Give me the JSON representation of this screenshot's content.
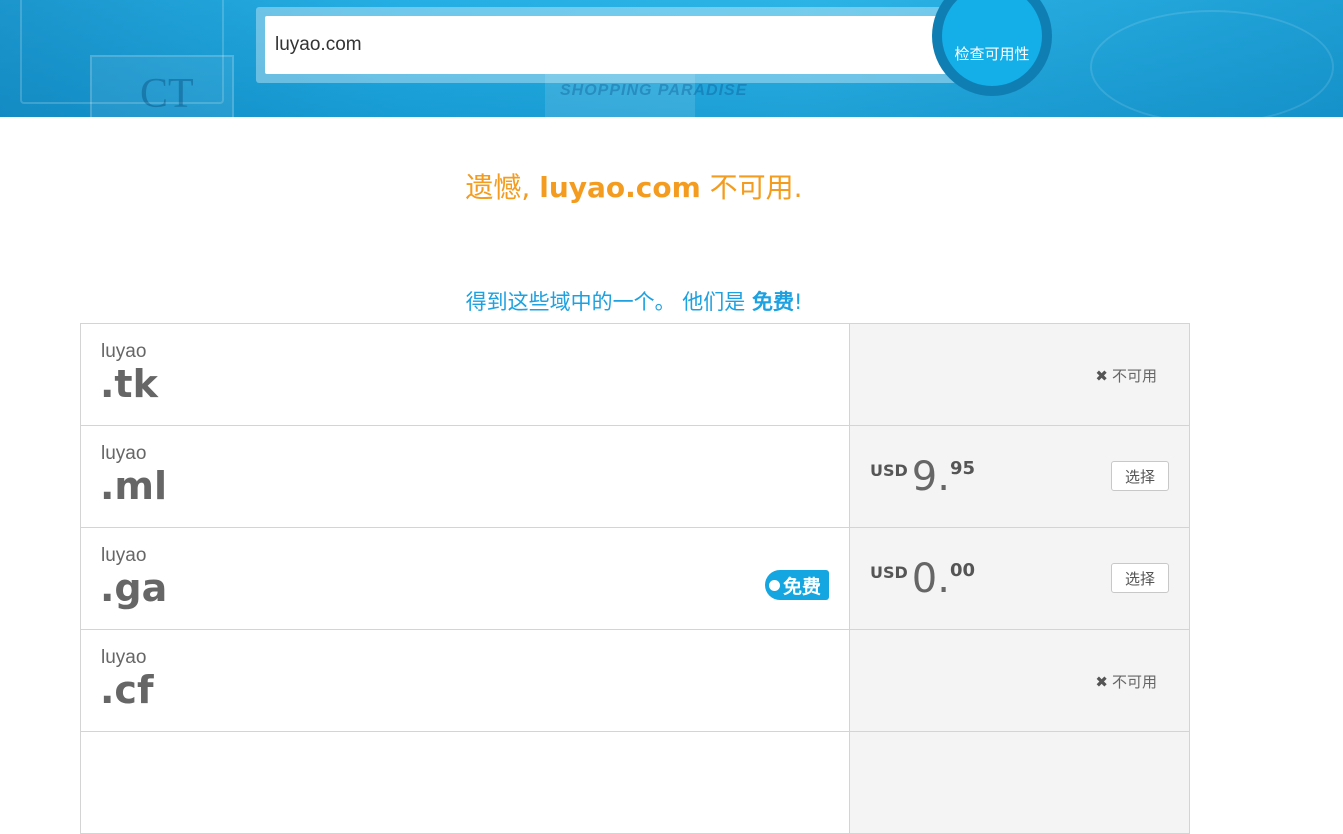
{
  "search": {
    "value": "luyao.com",
    "button_label": "检查可用性"
  },
  "hero_decor": {
    "sign_text": "SHOPPING PARADISE",
    "ct_text": "CT"
  },
  "result": {
    "prefix": "遗憾, ",
    "domain": "luyao.com",
    "suffix": " 不可用."
  },
  "offer": {
    "text": "得到这些域中的一个。 他们是 ",
    "free": "免费",
    "end": "!"
  },
  "rows": [
    {
      "sld": "luyao",
      "tld": ".tk",
      "status": "unavailable",
      "unavailable_label": "不可用"
    },
    {
      "sld": "luyao",
      "tld": ".ml",
      "status": "available",
      "currency": "USD",
      "price_int": "9.",
      "price_dec": "95",
      "select_label": "选择"
    },
    {
      "sld": "luyao",
      "tld": ".ga",
      "status": "available",
      "free_badge": "免费",
      "currency": "USD",
      "price_int": "0.",
      "price_dec": "00",
      "select_label": "选择"
    },
    {
      "sld": "luyao",
      "tld": ".cf",
      "status": "unavailable",
      "unavailable_label": "不可用"
    }
  ],
  "colors": {
    "accent_blue": "#14aee8",
    "warning_orange": "#f39c1f",
    "offer_blue": "#1da1e0"
  },
  "icons": {
    "unavailable": "close-x-icon",
    "free": "dot-icon"
  }
}
